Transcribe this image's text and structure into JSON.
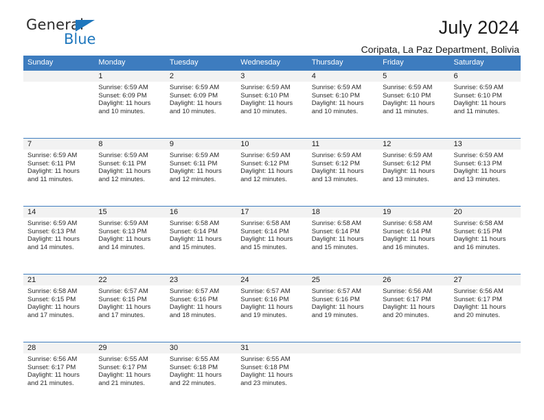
{
  "logo": {
    "word_top": "General",
    "word_bottom": "Blue",
    "triangle_color": "#1f77bd",
    "text_color": "#2b2b2b"
  },
  "header": {
    "title": "July 2024",
    "subtitle": "Coripata, La Paz Department, Bolivia"
  },
  "theme": {
    "header_bg": "#3d7cbf",
    "header_text": "#ffffff",
    "daynum_band_bg": "#f2f2f2",
    "cell_bg": "#ffffff",
    "row_rule": "#3d7cbf"
  },
  "calendar": {
    "weekday_headers": [
      "Sunday",
      "Monday",
      "Tuesday",
      "Wednesday",
      "Thursday",
      "Friday",
      "Saturday"
    ],
    "weeks": [
      [
        {
          "day": "",
          "sunrise": "",
          "sunset": "",
          "daylight_1": "",
          "daylight_2": ""
        },
        {
          "day": "1",
          "sunrise": "Sunrise: 6:59 AM",
          "sunset": "Sunset: 6:09 PM",
          "daylight_1": "Daylight: 11 hours",
          "daylight_2": "and 10 minutes."
        },
        {
          "day": "2",
          "sunrise": "Sunrise: 6:59 AM",
          "sunset": "Sunset: 6:09 PM",
          "daylight_1": "Daylight: 11 hours",
          "daylight_2": "and 10 minutes."
        },
        {
          "day": "3",
          "sunrise": "Sunrise: 6:59 AM",
          "sunset": "Sunset: 6:10 PM",
          "daylight_1": "Daylight: 11 hours",
          "daylight_2": "and 10 minutes."
        },
        {
          "day": "4",
          "sunrise": "Sunrise: 6:59 AM",
          "sunset": "Sunset: 6:10 PM",
          "daylight_1": "Daylight: 11 hours",
          "daylight_2": "and 10 minutes."
        },
        {
          "day": "5",
          "sunrise": "Sunrise: 6:59 AM",
          "sunset": "Sunset: 6:10 PM",
          "daylight_1": "Daylight: 11 hours",
          "daylight_2": "and 11 minutes."
        },
        {
          "day": "6",
          "sunrise": "Sunrise: 6:59 AM",
          "sunset": "Sunset: 6:10 PM",
          "daylight_1": "Daylight: 11 hours",
          "daylight_2": "and 11 minutes."
        }
      ],
      [
        {
          "day": "7",
          "sunrise": "Sunrise: 6:59 AM",
          "sunset": "Sunset: 6:11 PM",
          "daylight_1": "Daylight: 11 hours",
          "daylight_2": "and 11 minutes."
        },
        {
          "day": "8",
          "sunrise": "Sunrise: 6:59 AM",
          "sunset": "Sunset: 6:11 PM",
          "daylight_1": "Daylight: 11 hours",
          "daylight_2": "and 12 minutes."
        },
        {
          "day": "9",
          "sunrise": "Sunrise: 6:59 AM",
          "sunset": "Sunset: 6:11 PM",
          "daylight_1": "Daylight: 11 hours",
          "daylight_2": "and 12 minutes."
        },
        {
          "day": "10",
          "sunrise": "Sunrise: 6:59 AM",
          "sunset": "Sunset: 6:12 PM",
          "daylight_1": "Daylight: 11 hours",
          "daylight_2": "and 12 minutes."
        },
        {
          "day": "11",
          "sunrise": "Sunrise: 6:59 AM",
          "sunset": "Sunset: 6:12 PM",
          "daylight_1": "Daylight: 11 hours",
          "daylight_2": "and 13 minutes."
        },
        {
          "day": "12",
          "sunrise": "Sunrise: 6:59 AM",
          "sunset": "Sunset: 6:12 PM",
          "daylight_1": "Daylight: 11 hours",
          "daylight_2": "and 13 minutes."
        },
        {
          "day": "13",
          "sunrise": "Sunrise: 6:59 AM",
          "sunset": "Sunset: 6:13 PM",
          "daylight_1": "Daylight: 11 hours",
          "daylight_2": "and 13 minutes."
        }
      ],
      [
        {
          "day": "14",
          "sunrise": "Sunrise: 6:59 AM",
          "sunset": "Sunset: 6:13 PM",
          "daylight_1": "Daylight: 11 hours",
          "daylight_2": "and 14 minutes."
        },
        {
          "day": "15",
          "sunrise": "Sunrise: 6:59 AM",
          "sunset": "Sunset: 6:13 PM",
          "daylight_1": "Daylight: 11 hours",
          "daylight_2": "and 14 minutes."
        },
        {
          "day": "16",
          "sunrise": "Sunrise: 6:58 AM",
          "sunset": "Sunset: 6:14 PM",
          "daylight_1": "Daylight: 11 hours",
          "daylight_2": "and 15 minutes."
        },
        {
          "day": "17",
          "sunrise": "Sunrise: 6:58 AM",
          "sunset": "Sunset: 6:14 PM",
          "daylight_1": "Daylight: 11 hours",
          "daylight_2": "and 15 minutes."
        },
        {
          "day": "18",
          "sunrise": "Sunrise: 6:58 AM",
          "sunset": "Sunset: 6:14 PM",
          "daylight_1": "Daylight: 11 hours",
          "daylight_2": "and 15 minutes."
        },
        {
          "day": "19",
          "sunrise": "Sunrise: 6:58 AM",
          "sunset": "Sunset: 6:14 PM",
          "daylight_1": "Daylight: 11 hours",
          "daylight_2": "and 16 minutes."
        },
        {
          "day": "20",
          "sunrise": "Sunrise: 6:58 AM",
          "sunset": "Sunset: 6:15 PM",
          "daylight_1": "Daylight: 11 hours",
          "daylight_2": "and 16 minutes."
        }
      ],
      [
        {
          "day": "21",
          "sunrise": "Sunrise: 6:58 AM",
          "sunset": "Sunset: 6:15 PM",
          "daylight_1": "Daylight: 11 hours",
          "daylight_2": "and 17 minutes."
        },
        {
          "day": "22",
          "sunrise": "Sunrise: 6:57 AM",
          "sunset": "Sunset: 6:15 PM",
          "daylight_1": "Daylight: 11 hours",
          "daylight_2": "and 17 minutes."
        },
        {
          "day": "23",
          "sunrise": "Sunrise: 6:57 AM",
          "sunset": "Sunset: 6:16 PM",
          "daylight_1": "Daylight: 11 hours",
          "daylight_2": "and 18 minutes."
        },
        {
          "day": "24",
          "sunrise": "Sunrise: 6:57 AM",
          "sunset": "Sunset: 6:16 PM",
          "daylight_1": "Daylight: 11 hours",
          "daylight_2": "and 19 minutes."
        },
        {
          "day": "25",
          "sunrise": "Sunrise: 6:57 AM",
          "sunset": "Sunset: 6:16 PM",
          "daylight_1": "Daylight: 11 hours",
          "daylight_2": "and 19 minutes."
        },
        {
          "day": "26",
          "sunrise": "Sunrise: 6:56 AM",
          "sunset": "Sunset: 6:17 PM",
          "daylight_1": "Daylight: 11 hours",
          "daylight_2": "and 20 minutes."
        },
        {
          "day": "27",
          "sunrise": "Sunrise: 6:56 AM",
          "sunset": "Sunset: 6:17 PM",
          "daylight_1": "Daylight: 11 hours",
          "daylight_2": "and 20 minutes."
        }
      ],
      [
        {
          "day": "28",
          "sunrise": "Sunrise: 6:56 AM",
          "sunset": "Sunset: 6:17 PM",
          "daylight_1": "Daylight: 11 hours",
          "daylight_2": "and 21 minutes."
        },
        {
          "day": "29",
          "sunrise": "Sunrise: 6:55 AM",
          "sunset": "Sunset: 6:17 PM",
          "daylight_1": "Daylight: 11 hours",
          "daylight_2": "and 21 minutes."
        },
        {
          "day": "30",
          "sunrise": "Sunrise: 6:55 AM",
          "sunset": "Sunset: 6:18 PM",
          "daylight_1": "Daylight: 11 hours",
          "daylight_2": "and 22 minutes."
        },
        {
          "day": "31",
          "sunrise": "Sunrise: 6:55 AM",
          "sunset": "Sunset: 6:18 PM",
          "daylight_1": "Daylight: 11 hours",
          "daylight_2": "and 23 minutes."
        },
        {
          "day": "",
          "sunrise": "",
          "sunset": "",
          "daylight_1": "",
          "daylight_2": ""
        },
        {
          "day": "",
          "sunrise": "",
          "sunset": "",
          "daylight_1": "",
          "daylight_2": ""
        },
        {
          "day": "",
          "sunrise": "",
          "sunset": "",
          "daylight_1": "",
          "daylight_2": ""
        }
      ]
    ]
  }
}
